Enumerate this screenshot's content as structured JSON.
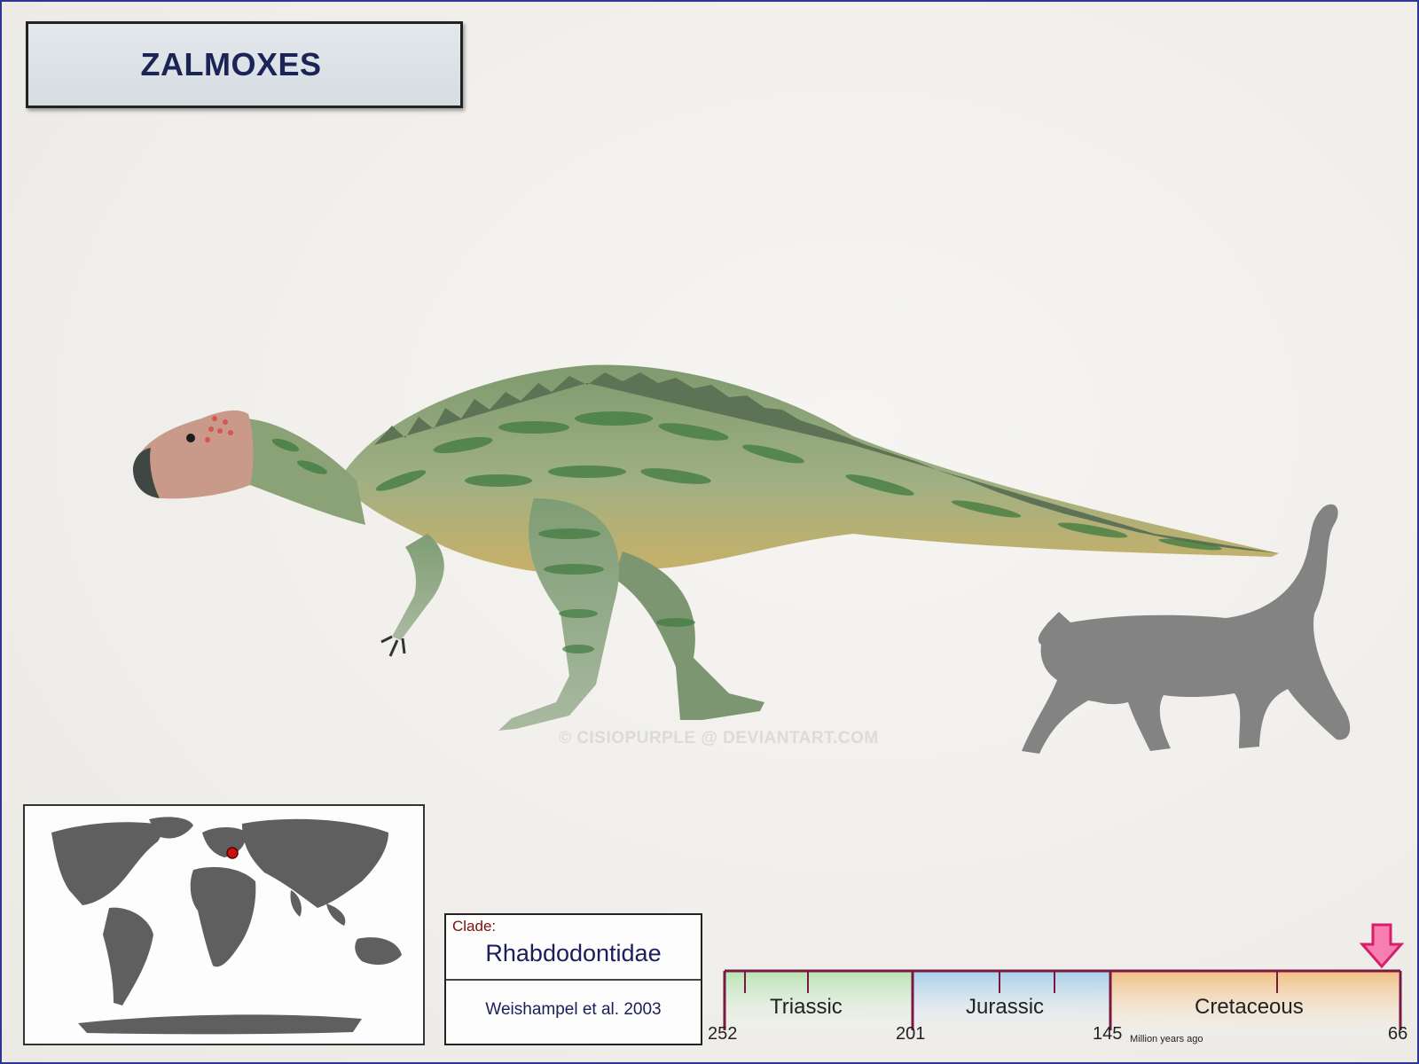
{
  "title": "ZALMOXES",
  "watermark": "© CISIOPURPLE @ DEVIANTART.COM",
  "clade": {
    "label": "Clade:",
    "name": "Rhabdodontidae",
    "author": "Weishampel et al. 2003"
  },
  "timeline": {
    "periods": [
      {
        "name": "Triassic",
        "color": "#c9eac6"
      },
      {
        "name": "Jurassic",
        "color": "#bcd8ec"
      },
      {
        "name": "Cretaceous",
        "color": "#f4c890"
      }
    ],
    "ticks": [
      "252",
      "201",
      "145",
      "66"
    ],
    "unit_label": "Million years ago",
    "marker_color": "#e0337a",
    "axis_color": "#7a1840"
  },
  "map": {
    "land_color": "#5f5f5f",
    "location_color": "#cc1111"
  },
  "icons": {
    "animal": "dinosaur-illustration",
    "scale": "cat-silhouette-icon",
    "marker": "down-arrow-icon"
  }
}
